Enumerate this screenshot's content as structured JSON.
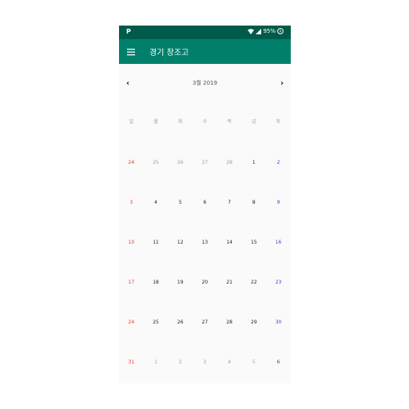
{
  "status": {
    "app_icon": "P",
    "battery": "95%"
  },
  "appbar": {
    "menu_icon": "hamburger-menu-icon",
    "title": "경기 창조고"
  },
  "calendar": {
    "prev_icon": "chevron-left-icon",
    "next_icon": "chevron-right-icon",
    "month_label": "3월 2019",
    "weekdays": [
      "일",
      "월",
      "화",
      "수",
      "목",
      "금",
      "토"
    ],
    "weeks": [
      [
        {
          "d": "24",
          "m": "prev"
        },
        {
          "d": "25",
          "m": "prev"
        },
        {
          "d": "26",
          "m": "prev"
        },
        {
          "d": "27",
          "m": "prev"
        },
        {
          "d": "28",
          "m": "prev"
        },
        {
          "d": "1",
          "m": "cur"
        },
        {
          "d": "2",
          "m": "cur"
        }
      ],
      [
        {
          "d": "3",
          "m": "cur"
        },
        {
          "d": "4",
          "m": "cur"
        },
        {
          "d": "5",
          "m": "cur"
        },
        {
          "d": "6",
          "m": "cur"
        },
        {
          "d": "7",
          "m": "cur"
        },
        {
          "d": "8",
          "m": "cur"
        },
        {
          "d": "9",
          "m": "cur"
        }
      ],
      [
        {
          "d": "10",
          "m": "cur"
        },
        {
          "d": "11",
          "m": "cur"
        },
        {
          "d": "12",
          "m": "cur"
        },
        {
          "d": "13",
          "m": "cur"
        },
        {
          "d": "14",
          "m": "cur"
        },
        {
          "d": "15",
          "m": "cur"
        },
        {
          "d": "16",
          "m": "cur"
        }
      ],
      [
        {
          "d": "17",
          "m": "cur"
        },
        {
          "d": "18",
          "m": "cur"
        },
        {
          "d": "19",
          "m": "cur"
        },
        {
          "d": "20",
          "m": "cur"
        },
        {
          "d": "21",
          "m": "cur"
        },
        {
          "d": "22",
          "m": "cur"
        },
        {
          "d": "23",
          "m": "cur"
        }
      ],
      [
        {
          "d": "24",
          "m": "cur"
        },
        {
          "d": "25",
          "m": "cur"
        },
        {
          "d": "26",
          "m": "cur"
        },
        {
          "d": "27",
          "m": "cur"
        },
        {
          "d": "28",
          "m": "cur"
        },
        {
          "d": "29",
          "m": "cur"
        },
        {
          "d": "30",
          "m": "cur"
        }
      ],
      [
        {
          "d": "31",
          "m": "cur"
        },
        {
          "d": "1",
          "m": "next"
        },
        {
          "d": "2",
          "m": "next"
        },
        {
          "d": "3",
          "m": "next"
        },
        {
          "d": "4",
          "m": "next"
        },
        {
          "d": "5",
          "m": "next"
        },
        {
          "d": "6",
          "m": "next"
        }
      ]
    ]
  },
  "colors": {
    "statusbar": "#005b4a",
    "appbar": "#00806b",
    "sunday": "#e53935",
    "saturday": "#3d3dd8"
  }
}
